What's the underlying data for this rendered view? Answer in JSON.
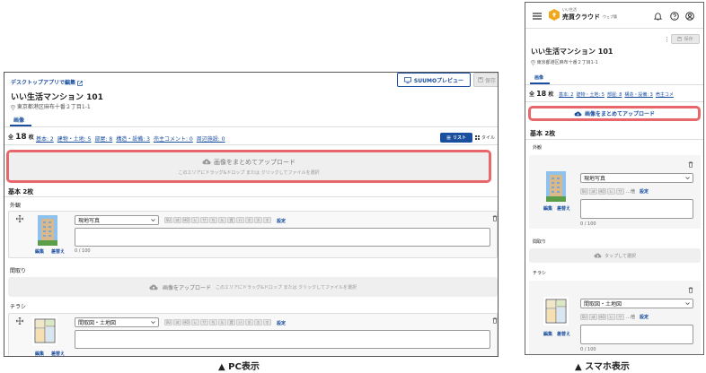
{
  "pc": {
    "desktop_link": "デスクトップアプリで編集",
    "preview_label": "SUUMOプレビュー",
    "save_label": "保存",
    "title": "いい生活マンション 101",
    "address": "東京都港区麻布十番２丁目1-1",
    "tab_images": "画像",
    "total_prefix": "全",
    "total_count": "18",
    "total_suffix": "枚",
    "categories": [
      "基本: 2",
      "建物・土地: 5",
      "部屋: 8",
      "構造・設備: 3",
      "売主コメント: 0",
      "周辺施設: 0"
    ],
    "view_list": "リスト",
    "view_tile": "タイル",
    "upload_title": "画像をまとめてアップロード",
    "upload_sub": "このエリアにドラッグ&ドロップ または クリックしてファイルを選択",
    "section_basic": "基本 2枚",
    "group1_label": "外観",
    "item1_select": "現地写真",
    "item_setting": "設定",
    "item_edit": "編集",
    "item_replace": "差替え",
    "item_counter": "0 / 100",
    "group2_label": "間取り",
    "group2_upload": "画像をアップロード",
    "group2_sub": "このエリアにドラッグ&ドロップ または クリックしてファイルを選択",
    "group3_label": "チラシ",
    "item2_select": "間取図・土地図"
  },
  "sp": {
    "brand_small": "いい生活",
    "brand_main": "売買クラウド",
    "brand_sub": "ウェブ版",
    "save_label": "保存",
    "title": "いい生活マンション 101",
    "address": "東京都港区麻布十番２丁目1-1",
    "tab_images": "画像",
    "total_prefix": "全",
    "total_count": "18",
    "total_suffix": "枚",
    "categories": [
      "基本: 2",
      "建物・土地: 5",
      "部屋: 8",
      "構造・設備: 3",
      "売主コメ"
    ],
    "upload_title": "画像をまとめてアップロード",
    "section_basic": "基本 2枚",
    "group1_label": "外観",
    "item1_select": "現地写真",
    "item_more": "…他",
    "item_setting": "設定",
    "item_edit": "編集",
    "item_replace": "差替え",
    "item_counter": "0 / 100",
    "group2_label": "間取り",
    "group2_tap": "タップして選択",
    "group3_label": "チラシ",
    "item2_select": "間取図・土地図"
  },
  "captions": {
    "pc": "▲ PC表示",
    "sp": "▲ スマホ表示"
  },
  "tag_labels": [
    "SU",
    "at",
    "HO",
    "レ",
    "サ",
    "ち",
    "ル",
    "賃",
    "ハ",
    "ホ",
    "ホ",
    "ホ"
  ],
  "colors": {
    "accent": "#1a4fa0",
    "highlight": "#e8676a",
    "tab_underline": "#1a4fa0"
  }
}
